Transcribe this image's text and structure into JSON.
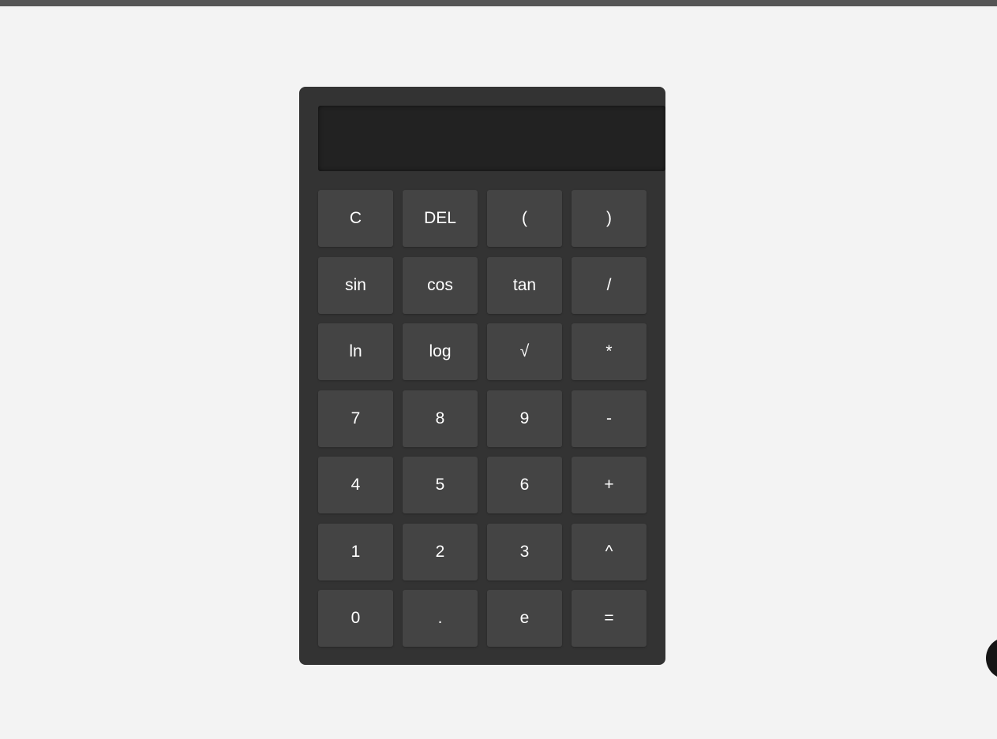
{
  "display": {
    "value": ""
  },
  "keys": [
    {
      "label": "C",
      "name": "clear-button"
    },
    {
      "label": "DEL",
      "name": "delete-button"
    },
    {
      "label": "(",
      "name": "open-paren-button"
    },
    {
      "label": ")",
      "name": "close-paren-button"
    },
    {
      "label": "sin",
      "name": "sin-button"
    },
    {
      "label": "cos",
      "name": "cos-button"
    },
    {
      "label": "tan",
      "name": "tan-button"
    },
    {
      "label": "/",
      "name": "divide-button"
    },
    {
      "label": "ln",
      "name": "ln-button"
    },
    {
      "label": "log",
      "name": "log-button"
    },
    {
      "label": "√",
      "name": "sqrt-button"
    },
    {
      "label": "*",
      "name": "multiply-button"
    },
    {
      "label": "7",
      "name": "digit-7-button"
    },
    {
      "label": "8",
      "name": "digit-8-button"
    },
    {
      "label": "9",
      "name": "digit-9-button"
    },
    {
      "label": "-",
      "name": "subtract-button"
    },
    {
      "label": "4",
      "name": "digit-4-button"
    },
    {
      "label": "5",
      "name": "digit-5-button"
    },
    {
      "label": "6",
      "name": "digit-6-button"
    },
    {
      "label": "+",
      "name": "add-button"
    },
    {
      "label": "1",
      "name": "digit-1-button"
    },
    {
      "label": "2",
      "name": "digit-2-button"
    },
    {
      "label": "3",
      "name": "digit-3-button"
    },
    {
      "label": "^",
      "name": "power-button"
    },
    {
      "label": "0",
      "name": "digit-0-button"
    },
    {
      "label": ".",
      "name": "decimal-button"
    },
    {
      "label": "e",
      "name": "euler-button"
    },
    {
      "label": "=",
      "name": "equals-button"
    }
  ],
  "colors": {
    "page_background": "#f3f3f3",
    "calculator_body": "#333333",
    "display_background": "#222222",
    "key_background": "#444444",
    "key_text": "#ffffff"
  }
}
